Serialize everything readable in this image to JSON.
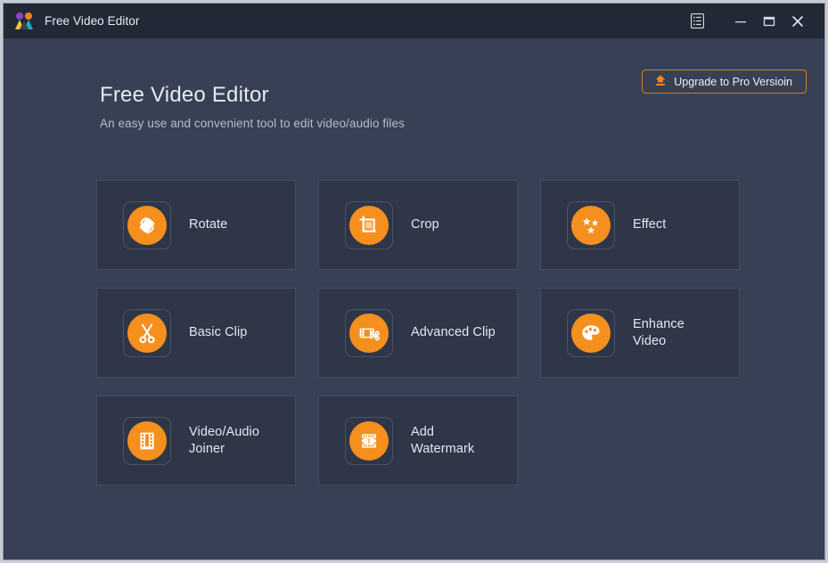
{
  "window": {
    "title": "Free Video Editor",
    "logo_icon": "app-logo-icon",
    "controls": [
      {
        "name": "menu-button",
        "icon": "list-menu-icon"
      },
      {
        "name": "minimize-button",
        "icon": "minimize-icon"
      },
      {
        "name": "maximize-button",
        "icon": "maximize-icon"
      },
      {
        "name": "close-button",
        "icon": "close-icon"
      }
    ]
  },
  "header": {
    "title": "Free Video Editor",
    "subtitle": "An easy use and convenient tool to edit video/audio files"
  },
  "upgrade": {
    "label": "Upgrade to Pro Versioin",
    "icon": "upgrade-arrow-icon"
  },
  "colors": {
    "accent_orange": "#f5901e",
    "titlebar_bg": "#222836",
    "body_bg": "#374055",
    "card_bg": "#2e3648",
    "card_border": "#434c61",
    "text_primary": "#e4e8ef",
    "text_secondary": "#b7bdc9",
    "upgrade_border": "#d4821e"
  },
  "tools": [
    {
      "id": "rotate",
      "label": "Rotate",
      "icon": "rotate-icon"
    },
    {
      "id": "crop",
      "label": "Crop",
      "icon": "crop-icon"
    },
    {
      "id": "effect",
      "label": "Effect",
      "icon": "stars-effect-icon"
    },
    {
      "id": "basic-clip",
      "label": "Basic Clip",
      "icon": "scissors-icon"
    },
    {
      "id": "advanced-clip",
      "label": "Advanced Clip",
      "icon": "film-scissors-icon"
    },
    {
      "id": "enhance-video",
      "label": "Enhance\nVideo",
      "icon": "palette-icon"
    },
    {
      "id": "video-audio-joiner",
      "label": "Video/Audio\nJoiner",
      "icon": "film-reel-icon"
    },
    {
      "id": "add-watermark",
      "label": "Add\nWatermark",
      "icon": "watermark-text-icon"
    }
  ]
}
